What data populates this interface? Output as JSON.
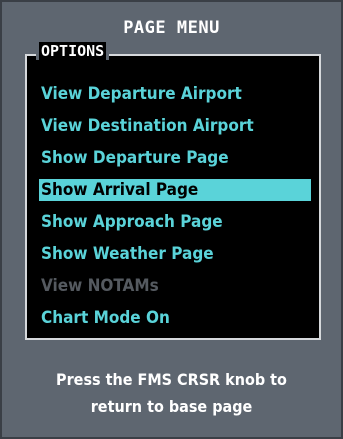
{
  "menu": {
    "title": "PAGE MENU",
    "options_label": "OPTIONS",
    "items": [
      {
        "label": "View Departure Airport",
        "state": "enabled"
      },
      {
        "label": "View Destination Airport",
        "state": "enabled"
      },
      {
        "label": "Show Departure Page",
        "state": "enabled"
      },
      {
        "label": "Show Arrival Page",
        "state": "selected"
      },
      {
        "label": "Show Approach Page",
        "state": "enabled"
      },
      {
        "label": "Show Weather Page",
        "state": "enabled"
      },
      {
        "label": "View NOTAMs",
        "state": "disabled"
      },
      {
        "label": "Chart Mode On",
        "state": "enabled"
      }
    ]
  },
  "footer": {
    "line1": "Press the FMS CRSR knob to",
    "line2": "return to base page"
  },
  "colors": {
    "window_bg": "#5e6670",
    "list_bg": "#000000",
    "item_text": "#5ad3d9",
    "selected_bg": "#5ad3d9",
    "disabled_text": "#555a60"
  }
}
